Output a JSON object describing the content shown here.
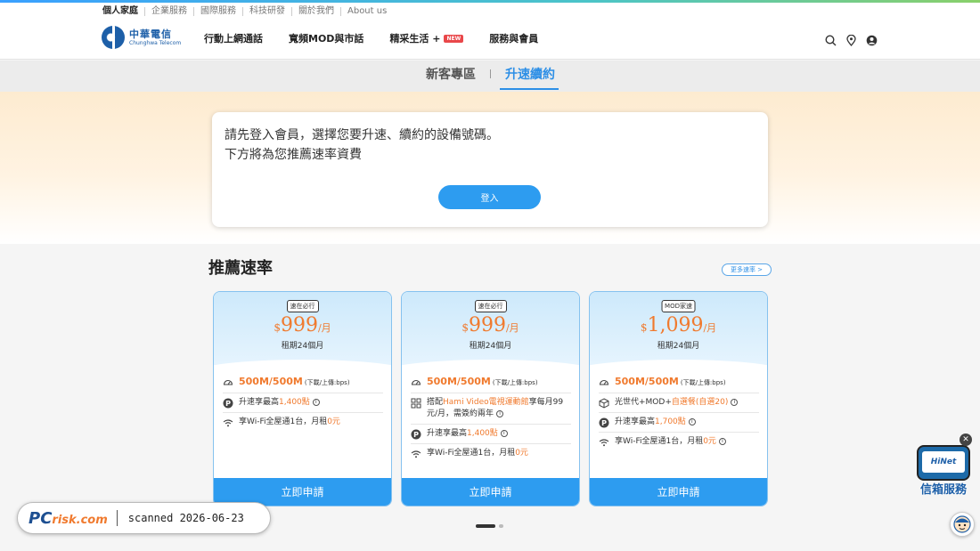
{
  "header": {
    "top_links": [
      "個人家庭",
      "企業服務",
      "國際服務",
      "科技研發",
      "關於我們",
      "About us"
    ],
    "logo_cn": "中華電信",
    "logo_en": "Chunghwa Telecom",
    "nav": [
      "行動上網通話",
      "寬頻MOD與市話",
      "精采生活 +",
      "服務與會員"
    ],
    "new_badge": "NEW"
  },
  "tabs": {
    "new_customer": "新客專區",
    "upgrade": "升速續約"
  },
  "login": {
    "line1": "請先登入會員，選擇您要升速、續約的設備號碼。",
    "line2": "下方將為您推薦速率資費",
    "button": "登入"
  },
  "recommend": {
    "title": "推薦速率",
    "more": "更多速率 >"
  },
  "plans": [
    {
      "tag": "速在必行",
      "currency": "$",
      "price": "999",
      "per": "/月",
      "term": "租期24個月",
      "speed": "500M/500M",
      "speed_unit": "(下載/上傳:bps)",
      "f1_pre": "升速享最高",
      "f1_hl": "1,400點",
      "f1_post": "",
      "f2_pre": "享Wi-Fi全屋通1台，月租",
      "f2_hl": "0元",
      "apply": "立即申請"
    },
    {
      "tag": "速在必行",
      "currency": "$",
      "price": "999",
      "per": "/月",
      "term": "租期24個月",
      "speed": "500M/500M",
      "speed_unit": "(下載/上傳:bps)",
      "f0_pre": "搭配",
      "f0_hl": "Hami Video電視運動館",
      "f0_post": "享每月99元/月，需簽約兩年",
      "f1_pre": "升速享最高",
      "f1_hl": "1,400點",
      "f2_pre": "享Wi-Fi全屋通1台，月租",
      "f2_hl": "0元",
      "apply": "立即申請"
    },
    {
      "tag": "MOD家速",
      "currency": "$",
      "price": "1,099",
      "per": "/月",
      "term": "租期24個月",
      "speed": "500M/500M",
      "speed_unit": "(下載/上傳:bps)",
      "f0_pre": "光世代+MOD+",
      "f0_hl": "自選餐(自選20)",
      "f1_pre": "升速享最高",
      "f1_hl": "1,700點",
      "f2_pre": "享Wi-Fi全屋通1台，月租",
      "f2_hl": "0元",
      "apply": "立即申請"
    }
  ],
  "watermark": {
    "logo": "PC",
    "logo2": "risk.com",
    "scan": "scanned 2026-06-23"
  },
  "hinet": {
    "screen": "HiNet",
    "label": "信箱服務",
    "close": "✕"
  },
  "colors": {
    "accent": "#2d9cf0",
    "highlight": "#f07a2e"
  }
}
